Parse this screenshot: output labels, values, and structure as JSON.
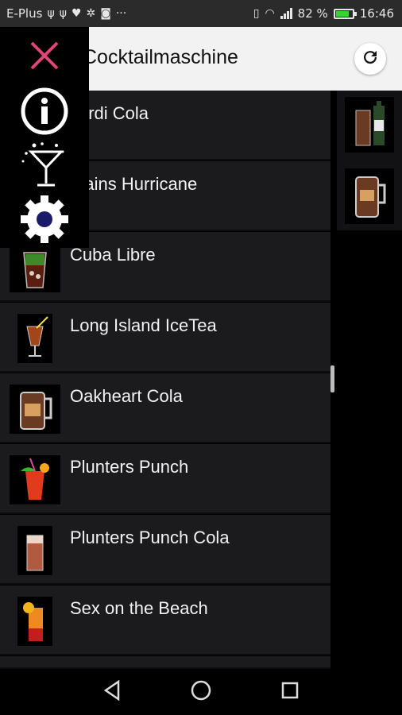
{
  "status_bar": {
    "carrier": "E-Plus",
    "icons": [
      "usb-icon",
      "usb-icon",
      "heart-icon",
      "settings-icon",
      "instagram-icon",
      "more-icon"
    ],
    "battery_percent": "82 %",
    "battery_level": 0.82,
    "time": "16:46"
  },
  "app_bar": {
    "title": "Cocktailmaschine",
    "refresh_icon": "refresh-icon"
  },
  "menu": {
    "items": [
      {
        "icon": "close-icon",
        "color": "#e0457a"
      },
      {
        "icon": "info-icon"
      },
      {
        "icon": "cocktail-glass-icon"
      },
      {
        "icon": "gear-icon"
      }
    ]
  },
  "cocktails": [
    {
      "name": "Bacardi Cola",
      "display": "cardi Cola"
    },
    {
      "name": "Captains Hurricane",
      "display": "ptains Hurricane"
    },
    {
      "name": "Cuba Libre",
      "display": "Cuba Libre"
    },
    {
      "name": "Long Island IceTea",
      "display": "Long Island IceTea"
    },
    {
      "name": "Oakheart Cola",
      "display": "Oakheart Cola"
    },
    {
      "name": "Plunters Punch",
      "display": "Plunters Punch"
    },
    {
      "name": "Plunters Punch Cola",
      "display": "Plunters Punch Cola"
    },
    {
      "name": "Sex on the Beach",
      "display": "Sex on the Beach"
    }
  ],
  "side_panel": {
    "items": [
      "bottle-icon",
      "mug-icon"
    ]
  },
  "navbar": {
    "buttons": [
      "back-icon",
      "home-icon",
      "recents-icon"
    ]
  },
  "colors": {
    "accent_close": "#e0457a",
    "row_bg": "#1b1b1d",
    "app_bar_bg": "#f2f2f2",
    "battery_green": "#3ccc3c"
  }
}
